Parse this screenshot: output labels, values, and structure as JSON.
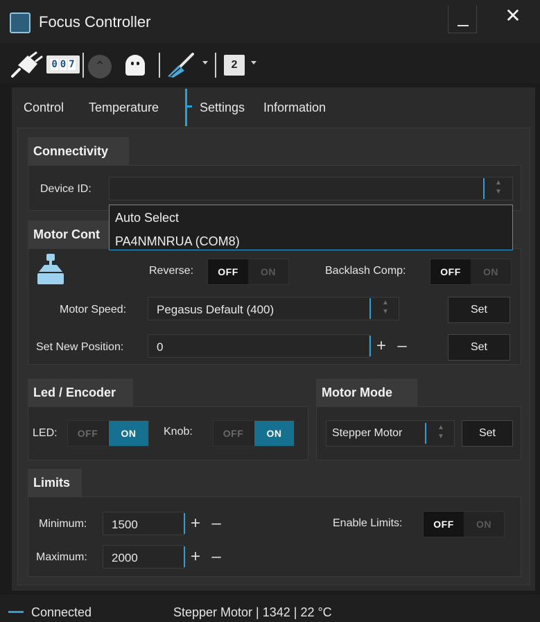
{
  "window": {
    "title": "Focus Controller",
    "close_glyph": "✕"
  },
  "toolbar": {
    "counter_digits": [
      "0",
      "0",
      "7"
    ],
    "up_glyph": "⌃",
    "profile_number": "2",
    "icons": [
      "plug-icon",
      "counter-icon",
      "home-up-icon",
      "ghost-icon",
      "broom-icon",
      "profile-badge"
    ]
  },
  "tabs": [
    {
      "label": "Control"
    },
    {
      "label": "Temperature"
    },
    {
      "label": "Settings"
    },
    {
      "label": "Information"
    }
  ],
  "connectivity": {
    "title": "Connectivity",
    "device_label": "Device ID:",
    "device_value": "",
    "options": [
      "Auto Select",
      "PA4NMNRUA (COM8)"
    ]
  },
  "motor": {
    "title": "Motor Cont",
    "reverse_label": "Reverse:",
    "backlash_label": "Backlash Comp:",
    "speed_label": "Motor Speed:",
    "speed_value": "Pegasus Default (400)",
    "position_label": "Set New Position:",
    "position_value": "0",
    "set_label": "Set"
  },
  "toggle": {
    "off": "OFF",
    "on": "ON"
  },
  "glyphs": {
    "plus": "+",
    "minus": "–"
  },
  "led": {
    "title": "Led / Encoder",
    "led_label": "LED:",
    "knob_label": "Knob:"
  },
  "motor_mode": {
    "title": "Motor Mode",
    "value": "Stepper Motor",
    "set_label": "Set"
  },
  "limits": {
    "title": "Limits",
    "min_label": "Minimum:",
    "min_value": "1500",
    "max_label": "Maximum:",
    "max_value": "2000",
    "enable_label": "Enable Limits:"
  },
  "status": {
    "connection": "Connected",
    "details": "Stepper Motor | 1342 | 22 °C"
  },
  "colors": {
    "accent": "#2b9fd6",
    "on_fill": "#16708f",
    "background": "#1b1b1b"
  }
}
